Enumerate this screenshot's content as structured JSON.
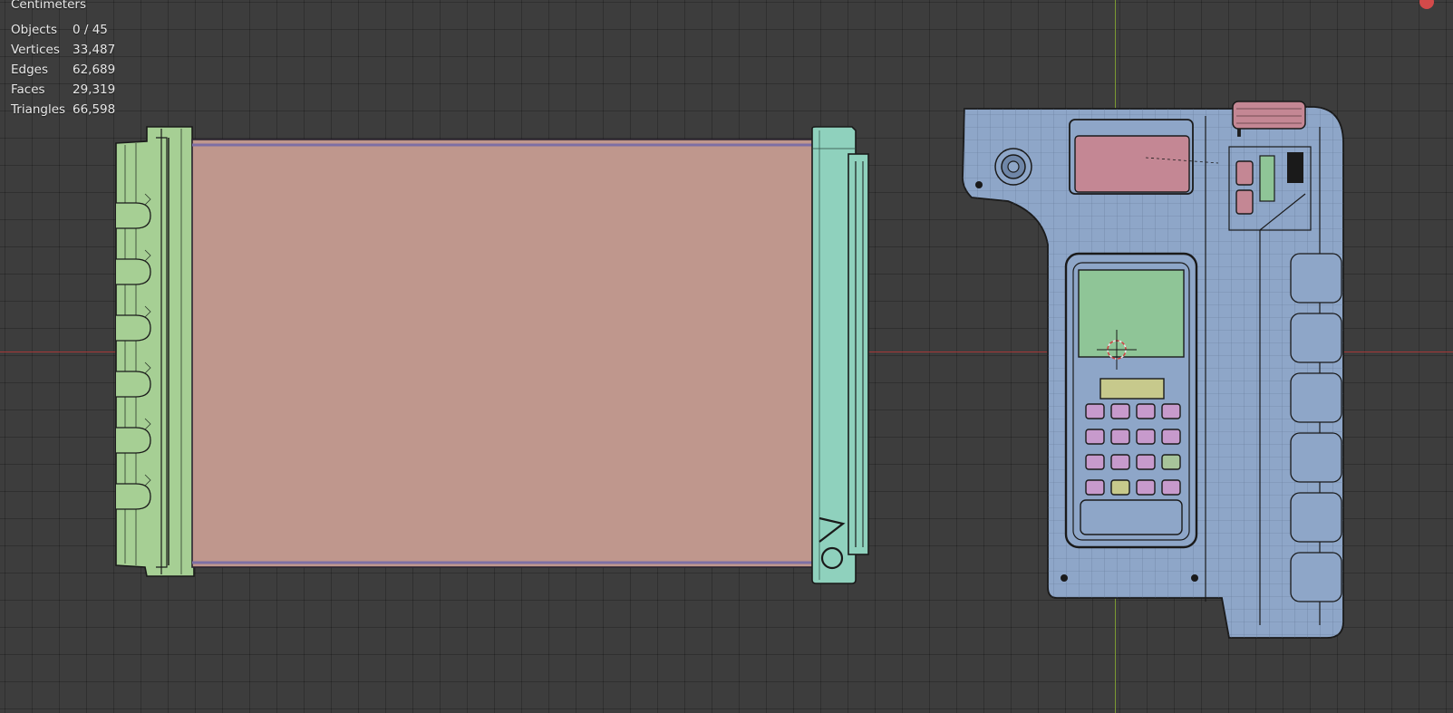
{
  "viewport": {
    "units": "Centimeters"
  },
  "statistics": [
    {
      "label": "Objects",
      "value": "0 / 45"
    },
    {
      "label": "Vertices",
      "value": "33,487"
    },
    {
      "label": "Edges",
      "value": "62,689"
    },
    {
      "label": "Faces",
      "value": "29,319"
    },
    {
      "label": "Triangles",
      "value": "66,598"
    }
  ],
  "colors": {
    "background": "#3d3d3d",
    "grid": "#333333",
    "x_axis": "#a53838",
    "y_axis": "#7c9a33",
    "green_part": "#a6cf94",
    "pink_panel": "#bf978d",
    "teal_part": "#8fd1bd",
    "blue_body": "#8ea6c8",
    "red_parts": "#c48794",
    "screen_green": "#8fc597",
    "display_yellow": "#c7c98c",
    "keypad_purple": "#c79acc"
  },
  "objects": {
    "left_logo": "VO"
  }
}
